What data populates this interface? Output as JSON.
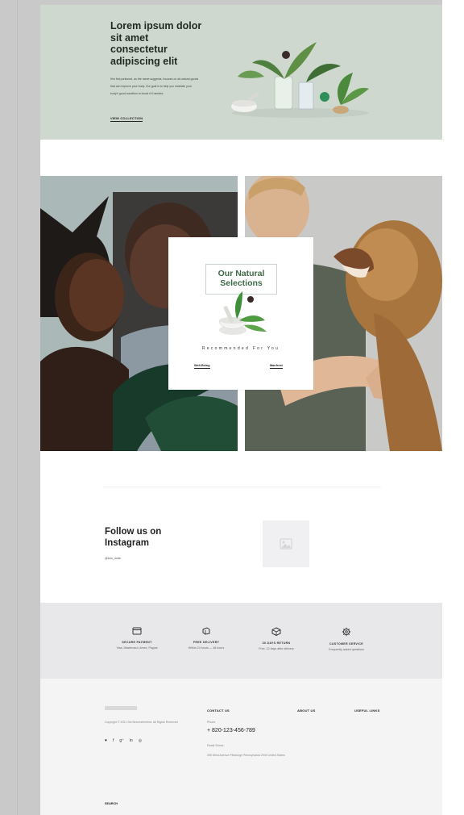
{
  "hero": {
    "title": "Lorem ipsum dolor sit amet consectetur adipiscing elit",
    "body": "Kim flat portioned, as the name suggests, focuses on all-natural goods that can improve your body. Our goal is to help you maintain your body's good condition to boost it if needed.",
    "link": "VIEW COLLECTION"
  },
  "promo": {
    "title": "Our Natural Selections",
    "subtitle": "Recommended For You",
    "link_left": "Well-Being",
    "link_right": "Manfrest"
  },
  "instagram": {
    "title": "Follow us on Instagram",
    "handle": "@kim_mide"
  },
  "features": [
    {
      "icon": "credit-card-icon",
      "title": "SECURE PAYMENT",
      "subtitle": "Visa, Mastercard, Amex, Paypal"
    },
    {
      "icon": "delivery-icon",
      "title": "FREE DELIVERY",
      "subtitle": "Within 24 hours — 48 hours"
    },
    {
      "icon": "box-icon",
      "title": "30 DAYS RETURN",
      "subtitle": "Free, 12 days after delivery"
    },
    {
      "icon": "gear-icon",
      "title": "CUSTOMER SERVICE",
      "subtitle": "Frequently asked questions"
    }
  ],
  "footer": {
    "copyright": "Copyright © 2021 Set Becomehnered. All Rights Reserved",
    "social": [
      "♥",
      "f",
      "g⁺",
      "in",
      "◎"
    ],
    "contact_head": "CONTACT US",
    "about_head": "ABOUT US",
    "useful_head": "USEFUL LINKS",
    "phone_label": "Phone",
    "phone": "+ 820-123-456-789",
    "store_label": "Retail Stores",
    "store_address": "255 West Avenue Pittsburgh Pennsylvania 2949 United States",
    "search_label": "SEARCH"
  },
  "colors": {
    "hero_bg": "#cfd8cf",
    "accent_green": "#3f6a4a",
    "features_bg": "#e8e8ea",
    "footer_bg": "#f4f4f4"
  }
}
